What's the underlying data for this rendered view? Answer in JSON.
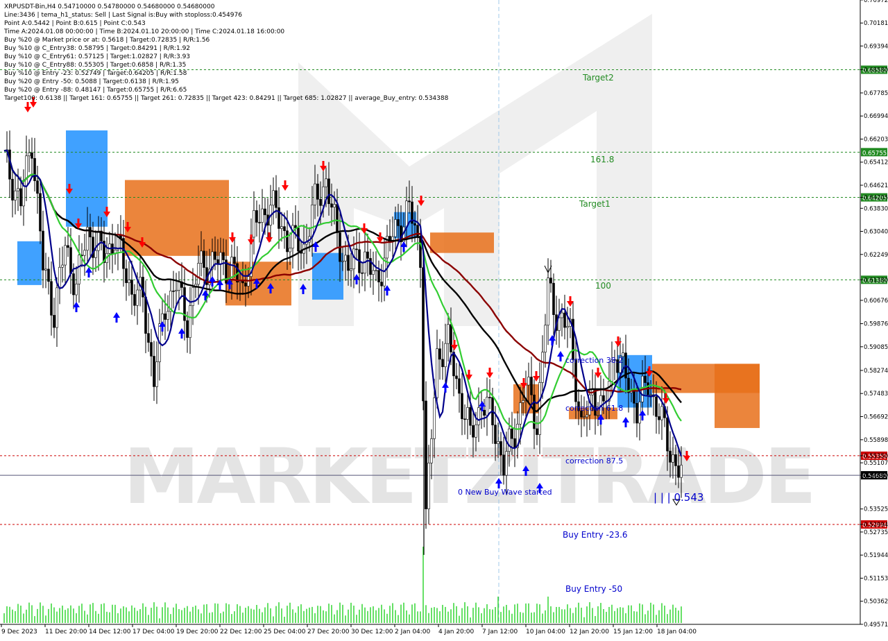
{
  "header": {
    "lines": [
      "XRPUSDT-Bin,H4  0.54710000 0.54780000 0.54680000 0.54680000",
      "Line:3436 | tema_h1_status: Sell | Last Signal is:Buy with stoploss:0.454976",
      "Point A:0.5442 | Point B:0.615 | Point C:0.543",
      "Time A:2024.01.08 00:00:00 | Time B:2024.01.10 20:00:00 | Time C:2024.01.18 16:00:00",
      "Buy %20 @ Market price or at: 0.5618 | Target:0.72835 | R/R:1.56",
      "Buy %10 @ C_Entry38: 0.58795 | Target:0.84291 | R/R:1.92",
      "Buy %10 @ C_Entry61: 0.57125 | Target:1.02827 | R/R:3.93",
      "Buy %10 @ C_Entry88: 0.55305 | Target:0.6858 | R/R:1.35",
      "Buy %10 @ Entry -23: 0.52749 | Target:0.64205 | R/R:1.58",
      "Buy %20 @ Entry -50: 0.5088 | Target:0.6138 | R/R:1.95",
      "Buy %20 @ Entry -88: 0.48147 | Target:0.65755 | R/R:6.65",
      "Target100: 0.6138 || Target 161: 0.65755 || Target 261: 0.72835 || Target 423: 0.84291 || Target 685: 1.02827 || average_Buy_entry: 0.534388"
    ]
  },
  "watermark": "MARKETZITRADE",
  "chart_data": {
    "type": "candlestick",
    "symbol": "XRPUSDT-Bin",
    "timeframe": "H4",
    "ohlc_last": {
      "open": 0.5471,
      "high": 0.5478,
      "low": 0.5468,
      "close": 0.5468
    },
    "ylim": [
      0.4957,
      0.7097
    ],
    "y_ticks": [
      "0.70972",
      "0.70181",
      "0.69394",
      "0.68580",
      "0.67785",
      "0.66994",
      "0.66203",
      "0.65412",
      "0.64621",
      "0.64205",
      "0.63830",
      "0.63040",
      "0.62249",
      "0.61380",
      "0.60676",
      "0.59876",
      "0.59085",
      "0.58274",
      "0.57483",
      "0.56692",
      "0.55898",
      "0.55350",
      "0.55107",
      "0.54680",
      "0.53525",
      "0.52994",
      "0.52735",
      "0.51944",
      "0.51153",
      "0.50362",
      "0.49571"
    ],
    "x_ticks": [
      "9 Dec 2023",
      "11 Dec 20:00",
      "14 Dec 12:00",
      "17 Dec 04:00",
      "19 Dec 20:00",
      "22 Dec 12:00",
      "25 Dec 04:00",
      "27 Dec 20:00",
      "30 Dec 12:00",
      "2 Jan 04:00",
      "4 Jan 20:00",
      "7 Jan 12:00",
      "10 Jan 04:00",
      "12 Jan 20:00",
      "15 Jan 12:00",
      "18 Jan 04:00"
    ],
    "levels": [
      {
        "label": "Target2",
        "value": 0.6858,
        "color": "#228b22",
        "style": "dashed",
        "badge": "0.68580"
      },
      {
        "label": "161.8",
        "value": 0.65755,
        "color": "#228b22",
        "style": "dashed",
        "badge": "0.65755"
      },
      {
        "label": "Target1",
        "value": 0.64205,
        "color": "#228b22",
        "style": "dashed",
        "badge": "0.64205"
      },
      {
        "label": "100",
        "value": 0.6138,
        "color": "#228b22",
        "style": "dashed",
        "badge": "0.61380"
      },
      {
        "label": "",
        "value": 0.5535,
        "color": "#cc0000",
        "style": "dashed",
        "badge": "0.55350"
      },
      {
        "label": "",
        "value": 0.5468,
        "color": "#555577",
        "style": "solid",
        "badge": "0.54680"
      },
      {
        "label": "",
        "value": 0.52994,
        "color": "#cc0000",
        "style": "dashed",
        "badge": "0.52994"
      }
    ],
    "annotations": [
      {
        "text": "correction 38.2",
        "color": "#0000cc"
      },
      {
        "text": "correction 61.8",
        "color": "#0000cc"
      },
      {
        "text": "correction 87.5",
        "color": "#0000cc"
      },
      {
        "text": "0 New Buy Wave started",
        "color": "#0000cc"
      },
      {
        "text": "| | | 0.543",
        "color": "#0000cc"
      },
      {
        "text": "Buy Entry -23.6",
        "color": "#0000cc"
      },
      {
        "text": "Buy Entry -50",
        "color": "#0000cc"
      }
    ],
    "series": [
      {
        "name": "",
        "color": "#8b0000"
      },
      {
        "name": "",
        "color": "#000000"
      },
      {
        "name": "",
        "color": "#32cd32"
      },
      {
        "name": "",
        "color": "#00008b"
      }
    ],
    "volume_color": "#00cc00",
    "cloud_colors": {
      "up": "#1e90ff",
      "down": "#e8701a"
    },
    "signal_colors": {
      "buy": "#0000ff",
      "sell": "#ff0000"
    }
  }
}
